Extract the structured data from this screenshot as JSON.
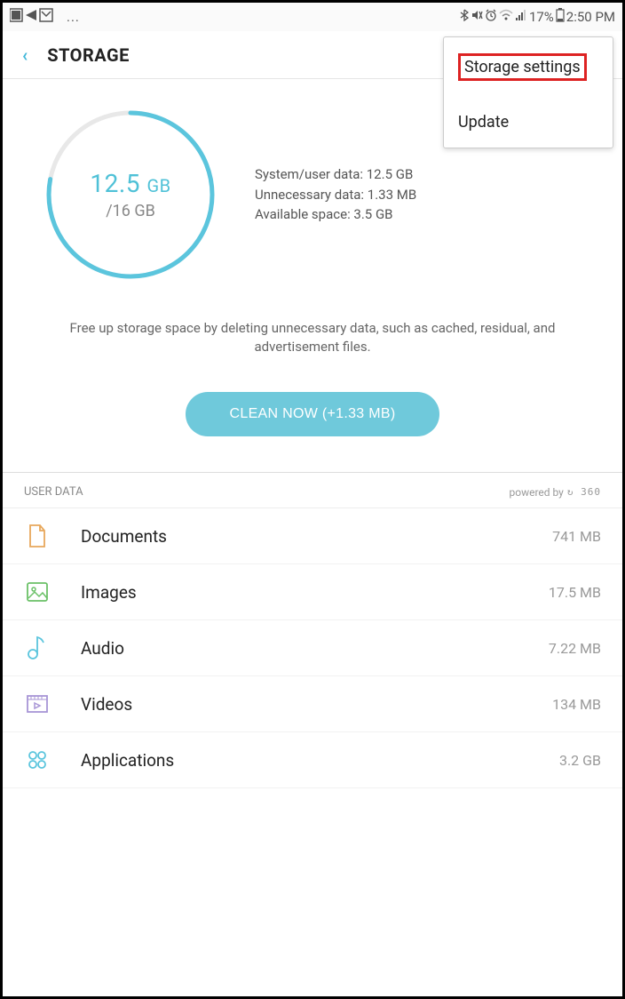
{
  "status": {
    "left_glyphs": "◪ ◅ ▣ ...",
    "battery_pct": "17%",
    "time": "2:50 PM"
  },
  "header": {
    "title": "STORAGE"
  },
  "popup": {
    "item1": "Storage settings",
    "item2": "Update"
  },
  "gauge": {
    "used_value": "12.5",
    "used_unit": "GB",
    "total": "/16 GB",
    "fraction_used": 0.78
  },
  "stats": {
    "line1": "System/user data: 12.5 GB",
    "line2": "Unnecessary data: 1.33 MB",
    "line3": "Available space: 3.5 GB"
  },
  "description": "Free up storage space by deleting unnecessary data, such as cached, residual, and advertisement files.",
  "clean_button_label": "CLEAN NOW (+1.33 MB)",
  "section": {
    "title": "USER DATA",
    "powered_prefix": "powered by",
    "powered_brand": "↻ 360"
  },
  "items": [
    {
      "label": "Documents",
      "size": "741 MB"
    },
    {
      "label": "Images",
      "size": "17.5 MB"
    },
    {
      "label": "Audio",
      "size": "7.22 MB"
    },
    {
      "label": "Videos",
      "size": "134 MB"
    },
    {
      "label": "Applications",
      "size": "3.2 GB"
    }
  ]
}
